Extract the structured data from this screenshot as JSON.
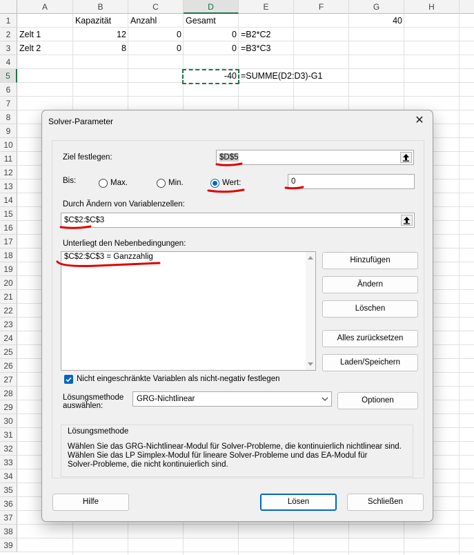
{
  "sheet": {
    "columns": [
      "A",
      "B",
      "C",
      "D",
      "E",
      "F",
      "G",
      "H"
    ],
    "rows": [
      "1",
      "2",
      "3",
      "4",
      "5",
      "6",
      "7",
      "8",
      "9",
      "10",
      "11",
      "12",
      "13",
      "14",
      "15",
      "16",
      "17",
      "18",
      "19",
      "20",
      "21",
      "22",
      "23",
      "24",
      "25",
      "26",
      "27",
      "28",
      "29",
      "30",
      "31",
      "32",
      "33",
      "34",
      "35",
      "36",
      "37",
      "38",
      "39"
    ],
    "cells": {
      "b1": "Kapazität",
      "c1": "Anzahl",
      "d1": "Gesamt",
      "g1": "40",
      "a2": "Zelt 1",
      "b2": "12",
      "c2": "0",
      "d2": "0",
      "e2": "=B2*C2",
      "a3": "Zelt 2",
      "b3": "8",
      "c3": "0",
      "d3": "0",
      "e3": "=B3*C3",
      "d5": "-40",
      "e5": "=SUMME(D2:D3)-G1"
    }
  },
  "dialog": {
    "title": "Solver-Parameter",
    "close_symbol": "✕",
    "objective_label": "Ziel festlegen:",
    "objective_value": "$D$5",
    "to_label": "Bis:",
    "max_label": "Max.",
    "min_label": "Min.",
    "value_label": "Wert:",
    "value_input": "0",
    "selected_option": "value",
    "variables_label": "Durch Ändern von Variablenzellen:",
    "variables_value": "$C$2:$C$3",
    "constraints_label": "Unterliegt den Nebenbedingungen:",
    "constraints": [
      "$C$2:$C$3 = Ganzzahlig"
    ],
    "buttons": {
      "add": "Hinzufügen",
      "change": "Ändern",
      "delete": "Löschen",
      "reset_all": "Alles zurücksetzen",
      "load_save": "Laden/Speichern",
      "options": "Optionen",
      "help": "Hilfe",
      "solve": "Lösen",
      "close": "Schließen"
    },
    "nonneg_label": "Nicht eingeschränkte Variablen als nicht-negativ festlegen",
    "nonneg_checked": true,
    "method_label_line1": "Lösungsmethode",
    "method_label_line2": "auswählen:",
    "method_value": "GRG-Nichtlinear",
    "method_group_title": "Lösungsmethode",
    "method_desc_line1": "Wählen Sie das GRG-Nichtlinear-Modul für Solver-Probleme, die kontinuierlich nichtlinear sind.",
    "method_desc_line2": "Wählen Sie das LP Simplex-Modul für lineare Solver-Probleme und das EA-Modul für",
    "method_desc_line3": "Solver-Probleme, die nicht kontinuierlich sind."
  },
  "colors": {
    "accent": "#0067c0",
    "excel_green": "#217346",
    "annotation_red": "#e00000"
  }
}
